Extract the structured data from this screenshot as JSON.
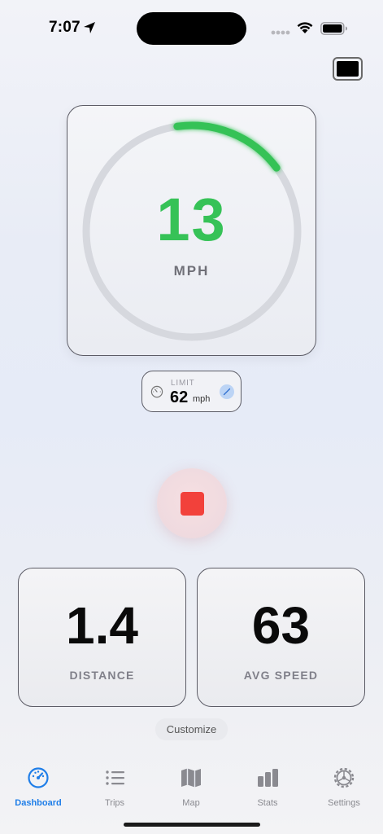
{
  "status_bar": {
    "time": "7:07"
  },
  "speedometer": {
    "speed": "13",
    "unit": "MPH",
    "progress": 0.17,
    "gauge_color": "#36c257",
    "track_color": "#d6d8de"
  },
  "limit": {
    "label": "LIMIT",
    "value": "62",
    "unit": "mph"
  },
  "stats": {
    "distance": {
      "value": "1.4",
      "label": "DISTANCE"
    },
    "avg_speed": {
      "value": "63",
      "label": "AVG SPEED"
    }
  },
  "customize_label": "Customize",
  "stop_color": "#f2413b",
  "accent_color": "#1f7ee8",
  "tabs": [
    {
      "label": "Dashboard",
      "icon": "speedometer-icon",
      "active": true
    },
    {
      "label": "Trips",
      "icon": "list-icon",
      "active": false
    },
    {
      "label": "Map",
      "icon": "map-icon",
      "active": false
    },
    {
      "label": "Stats",
      "icon": "bar-chart-icon",
      "active": false
    },
    {
      "label": "Settings",
      "icon": "gear-icon",
      "active": false
    }
  ]
}
